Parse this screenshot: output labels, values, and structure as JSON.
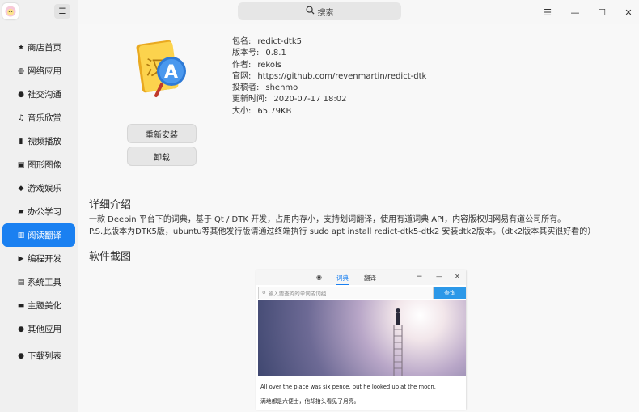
{
  "sidebar": {
    "toggle_icon": "list-icon",
    "items": [
      {
        "label": "商店首页",
        "icon": "star-icon",
        "glyph": "★"
      },
      {
        "label": "网络应用",
        "icon": "globe-icon",
        "glyph": "◍"
      },
      {
        "label": "社交沟通",
        "icon": "chat-icon",
        "glyph": "●"
      },
      {
        "label": "音乐欣赏",
        "icon": "music-icon",
        "glyph": "♫"
      },
      {
        "label": "视频播放",
        "icon": "film-icon",
        "glyph": "▮"
      },
      {
        "label": "图形图像",
        "icon": "image-icon",
        "glyph": "▣"
      },
      {
        "label": "游戏娱乐",
        "icon": "gamepad-icon",
        "glyph": "◆"
      },
      {
        "label": "办公学习",
        "icon": "folder-icon",
        "glyph": "▰"
      },
      {
        "label": "阅读翻译",
        "icon": "book-icon",
        "glyph": "▥"
      },
      {
        "label": "编程开发",
        "icon": "terminal-icon",
        "glyph": "▶"
      },
      {
        "label": "系统工具",
        "icon": "tools-icon",
        "glyph": "▤"
      },
      {
        "label": "主题美化",
        "icon": "monitor-icon",
        "glyph": "▬"
      },
      {
        "label": "其他应用",
        "icon": "more-icon",
        "glyph": "●"
      }
    ],
    "downloads": {
      "label": "下载列表",
      "icon": "download-icon",
      "glyph": "●"
    },
    "active_index": 8,
    "accent": "#1a80f1"
  },
  "titlebar": {
    "search_placeholder": "搜索",
    "menu_glyph": "☰",
    "min_glyph": "—",
    "max_glyph": "☐",
    "close_glyph": "✕"
  },
  "app": {
    "rows": [
      {
        "key": "包名:",
        "value": "redict-dtk5"
      },
      {
        "key": "版本号:",
        "value": "0.8.1"
      },
      {
        "key": "作者:",
        "value": "rekols"
      },
      {
        "key": "官网:",
        "value": "https://github.com/revenmartin/redict-dtk"
      },
      {
        "key": "投稿者:",
        "value": "shenmo"
      },
      {
        "key": "更新时间:",
        "value": "2020-07-17 18:02"
      },
      {
        "key": "大小:",
        "value": "65.79KB"
      }
    ],
    "reinstall_label": "重新安装",
    "uninstall_label": "卸载"
  },
  "detail": {
    "title": "详细介绍",
    "line1": "一款 Deepin 平台下的词典，基于 Qt / DTK 开发，占用内存小，支持划词翻译，使用有道词典 API，内容版权归网易有道公司所有。",
    "line2": "P.S.此版本为DTK5版，ubuntu等其他发行版请通过终端执行 sudo apt install redict-dtk5-dtk2 安装dtk2版本。（dtk2版本其实很好看的）"
  },
  "screenshots": {
    "title": "软件截图",
    "tab_dict": "词典",
    "tab_translate": "翻译",
    "search_placeholder": "输入要查询的单词或词组",
    "query_label": "查询",
    "caption_en": "All over the place was six pence, but he looked up at the moon.",
    "caption_zh": "满地都是六便士，他却抬头看见了月亮。"
  }
}
